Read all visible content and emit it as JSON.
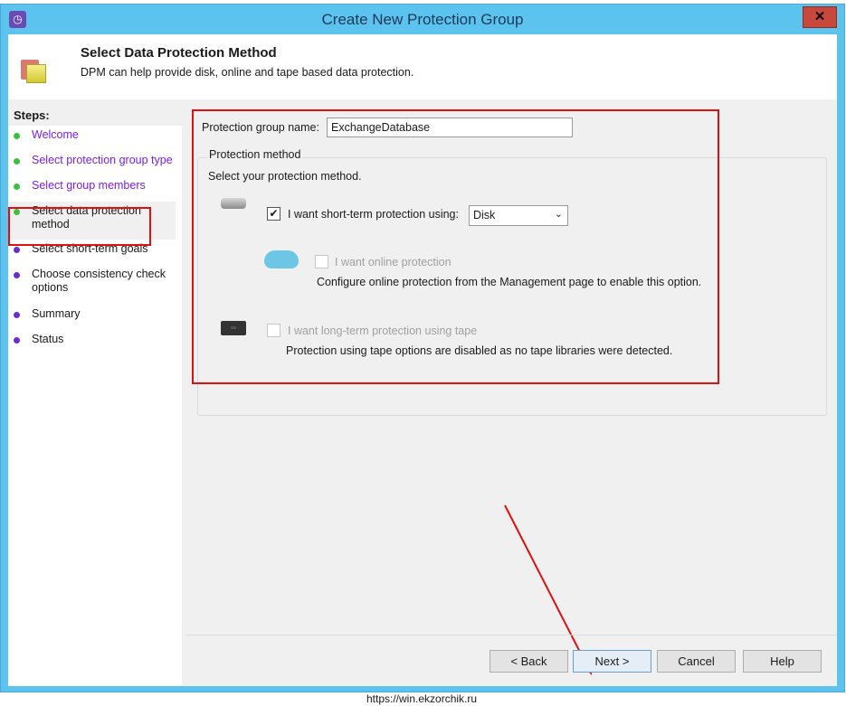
{
  "window": {
    "title": "Create New Protection Group"
  },
  "header": {
    "title": "Select Data Protection Method",
    "subtitle": "DPM can help provide disk, online and tape based data protection."
  },
  "steps": {
    "heading": "Steps:",
    "items": [
      {
        "label": "Welcome",
        "state": "done"
      },
      {
        "label": "Select protection group type",
        "state": "done"
      },
      {
        "label": "Select group members",
        "state": "done"
      },
      {
        "label": "Select data protection method",
        "state": "current"
      },
      {
        "label": "Select short-term goals",
        "state": "pending"
      },
      {
        "label": "Choose consistency check options",
        "state": "pending"
      },
      {
        "label": "Summary",
        "state": "pending"
      },
      {
        "label": "Status",
        "state": "pending"
      }
    ]
  },
  "form": {
    "name_label": "Protection group name:",
    "name_value": "ExchangeDatabase",
    "group_legend": "Protection method",
    "instruction": "Select your protection method.",
    "short_term": {
      "label": "I want short-term protection using:",
      "checked": true,
      "selected": "Disk"
    },
    "online": {
      "label": "I want online protection",
      "checked": false,
      "note": "Configure online protection from the Management page to enable this option."
    },
    "tape": {
      "label": "I want long-term protection using tape",
      "checked": false,
      "note": "Protection using tape options are disabled as no tape libraries were detected."
    }
  },
  "buttons": {
    "back": "< Back",
    "next": "Next >",
    "cancel": "Cancel",
    "help": "Help"
  },
  "footer": "https://win.ekzorchik.ru",
  "colors": {
    "titlebar": "#5bc3ee",
    "highlight": "#e01010",
    "done_dot": "#3fbf3f",
    "pending_dot": "#6a2fc9",
    "done_link": "#7b1ee6"
  }
}
